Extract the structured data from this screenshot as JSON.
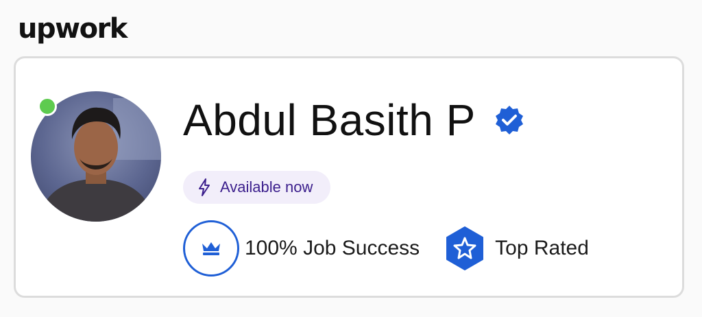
{
  "brand": {
    "logo_text": "upwork"
  },
  "profile": {
    "name": "Abdul Basith P",
    "verified_icon": "verified-badge-icon",
    "online": true,
    "availability": "Available now",
    "job_success": "100% Job Success",
    "top_rated": "Top Rated"
  },
  "colors": {
    "accent_blue": "#1f5fd6",
    "online_green": "#5ecb4f",
    "availability_bg": "#f2eefa",
    "availability_text": "#3b1e8c"
  }
}
